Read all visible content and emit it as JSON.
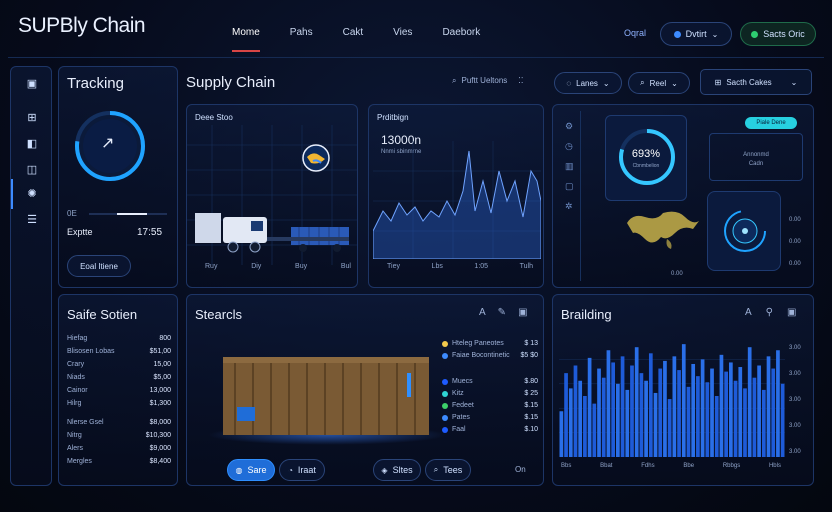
{
  "app": {
    "title": "SUPBly Chain"
  },
  "nav": {
    "items": [
      "Mome",
      "Pahs",
      "Cakt",
      "Vies",
      "Daebork"
    ]
  },
  "header": {
    "orgal": "Oqral",
    "dropdown": "Dvtirt",
    "status": "Sacts Oric"
  },
  "tracking": {
    "title": "Tracking",
    "label_left": "0E",
    "value_left": "Exptte",
    "value_right": "17:55",
    "button": "Eoal Itiene"
  },
  "supply": {
    "title": "Supply Chain",
    "toolbar": {
      "filter": "Puftt Ueltons",
      "lanes": "Lanes",
      "reel": "Reel",
      "search": "Sacth Cakes"
    },
    "map_card": {
      "title": "Deee Stoo",
      "ticks": [
        "Ruy",
        "Diy",
        "Buy",
        "Bul"
      ]
    },
    "stats_card": {
      "title": "Prditbign",
      "value": "13000n",
      "sub": "Nnmi sbinmrne",
      "ticks": [
        "Tiey",
        "Lbs",
        "1:05",
        "Tulh"
      ]
    }
  },
  "right": {
    "gauge_value": "693%",
    "gauge_sub": "Cbnmbelion",
    "badge": "Piale Dene",
    "card_text": [
      "Annonmd",
      "Cadn"
    ],
    "ticks": [
      "0.00",
      "0.00",
      "0.00",
      "0.00"
    ]
  },
  "safe": {
    "title": "Saife Sotien",
    "rows": [
      {
        "k": "Hiefag",
        "v": "800"
      },
      {
        "k": "Blisosen Lobas",
        "v": "$51,00"
      },
      {
        "k": "Crary",
        "v": "15,00"
      },
      {
        "k": "Niads",
        "v": "$5,00"
      },
      {
        "k": "Cainor",
        "v": "13,000"
      },
      {
        "k": "Hilrg",
        "v": "$1,300"
      },
      {
        "k": "Nlerse Gsel",
        "v": "$8,000"
      },
      {
        "k": "Nitrg",
        "v": "$10,300"
      },
      {
        "k": "Alers",
        "v": "$9,000"
      },
      {
        "k": "Mergles",
        "v": "$8,400"
      }
    ]
  },
  "stearcls": {
    "title": "Stearcls",
    "legend": [
      {
        "label": "Hteleg Paneotes",
        "value": "$ 13",
        "color": "#f2c94c"
      },
      {
        "label": "Faiae Bocontinetic",
        "value": "$5 $0",
        "color": "#3d8bff"
      },
      {
        "label": "Muecs",
        "value": "$.80",
        "color": "#1e5bff"
      },
      {
        "label": "Kitz",
        "value": "$ 25",
        "color": "#2fd4d4"
      },
      {
        "label": "Fedeet",
        "value": "$.15",
        "color": "#3ccf6a"
      },
      {
        "label": "Pates",
        "value": "$.15",
        "color": "#3d8bff"
      },
      {
        "label": "Faal",
        "value": "$.10",
        "color": "#1e5bff"
      }
    ],
    "buttons": [
      "Sare",
      "Iraat",
      "Sltes",
      "Tees"
    ],
    "footer": "On"
  },
  "brailding": {
    "title": "Brailding",
    "yticks": [
      "3.00",
      "3.00",
      "3.00",
      "3.00",
      "3.00"
    ],
    "xticks": [
      "Bbs",
      "Bbat",
      "Fdhs",
      "Bbe",
      "Rbbgs",
      "Hbls"
    ]
  },
  "chart_data": {
    "type": "bar",
    "values": [
      30,
      55,
      45,
      60,
      50,
      40,
      65,
      35,
      58,
      52,
      70,
      62,
      48,
      66,
      44,
      60,
      72,
      55,
      50,
      68,
      42,
      58,
      63,
      38,
      66,
      57,
      74,
      46,
      61,
      53,
      64,
      49,
      58,
      40,
      67,
      56,
      62,
      50,
      59,
      45,
      72,
      52,
      60,
      44,
      66,
      58,
      70,
      48
    ]
  }
}
